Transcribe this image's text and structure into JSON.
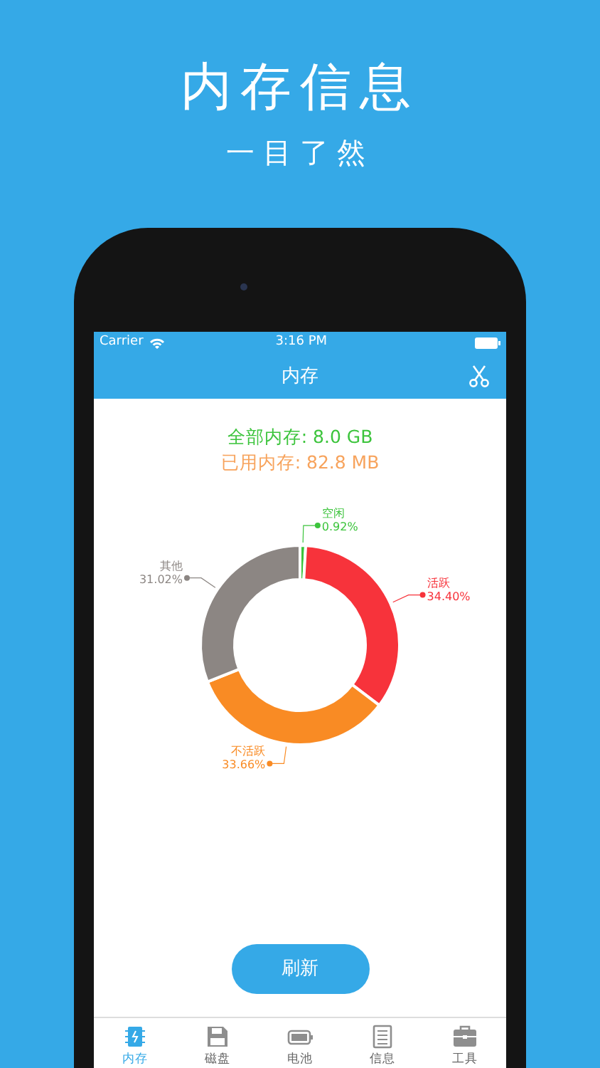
{
  "promo": {
    "title": "内存信息",
    "subtitle": "一目了然"
  },
  "status_bar": {
    "carrier": "Carrier",
    "time": "3:16 PM"
  },
  "nav": {
    "title": "内存"
  },
  "summary": [
    {
      "text": "全部内存: 8.0 GB",
      "color": "#3cc43c"
    },
    {
      "text": "已用内存: 82.8 MB",
      "color": "#f7a35c"
    }
  ],
  "chart_data": {
    "type": "donut",
    "categories": [
      "空闲",
      "活跃",
      "不活跃",
      "其他"
    ],
    "values": [
      0.92,
      34.4,
      33.66,
      31.02
    ],
    "value_labels": [
      "0.92%",
      "34.40%",
      "33.66%",
      "31.02%"
    ],
    "colors": [
      "#3cc43c",
      "#f7333b",
      "#f98b24",
      "#8c8683"
    ]
  },
  "refresh_button": "刷新",
  "tabs": [
    {
      "label": "内存",
      "kind": "chip",
      "selected": true
    },
    {
      "label": "磁盘",
      "kind": "disk",
      "selected": false
    },
    {
      "label": "电池",
      "kind": "battery",
      "selected": false
    },
    {
      "label": "信息",
      "kind": "list",
      "selected": false
    },
    {
      "label": "工具",
      "kind": "toolbox",
      "selected": false
    }
  ]
}
